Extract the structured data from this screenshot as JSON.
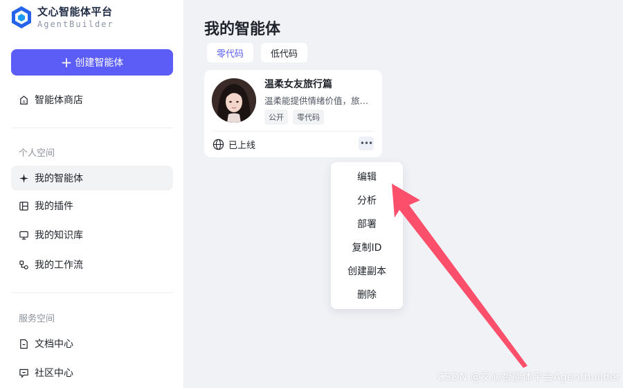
{
  "logo": {
    "title": "文心智能体平台",
    "subtitle": "AgentBuilder"
  },
  "sidebar": {
    "create_label": "创建智能体",
    "store_label": "智能体商店",
    "personal_section": "个人空间",
    "personal_items": [
      {
        "label": "我的智能体"
      },
      {
        "label": "我的插件"
      },
      {
        "label": "我的知识库"
      },
      {
        "label": "我的工作流"
      }
    ],
    "service_section": "服务空间",
    "service_items": [
      {
        "label": "文档中心"
      },
      {
        "label": "社区中心"
      }
    ]
  },
  "main": {
    "title": "我的智能体",
    "tabs": [
      {
        "label": "零代码"
      },
      {
        "label": "低代码"
      }
    ],
    "card": {
      "title": "温柔女友旅行篇",
      "description": "温柔能提供情绪价值，旅行陪伴…",
      "tags": [
        "公开",
        "零代码"
      ],
      "status": "已上线"
    },
    "menu": [
      {
        "label": "编辑"
      },
      {
        "label": "分析"
      },
      {
        "label": "部署"
      },
      {
        "label": "复制ID"
      },
      {
        "label": "创建副本"
      },
      {
        "label": "删除"
      }
    ]
  },
  "watermark": "CSDN @文心智能体平台Agentbuilder",
  "colors": {
    "accent": "#5b5df6",
    "arrow": "#fb4f6b"
  },
  "icons": {
    "store": "store-icon",
    "agent": "sparkle-icon",
    "plugin": "plugin-icon",
    "knowledge": "monitor-icon",
    "workflow": "workflow-icon",
    "doc": "document-icon",
    "community": "chat-icon",
    "globe": "globe-icon",
    "more": "more-icon"
  }
}
